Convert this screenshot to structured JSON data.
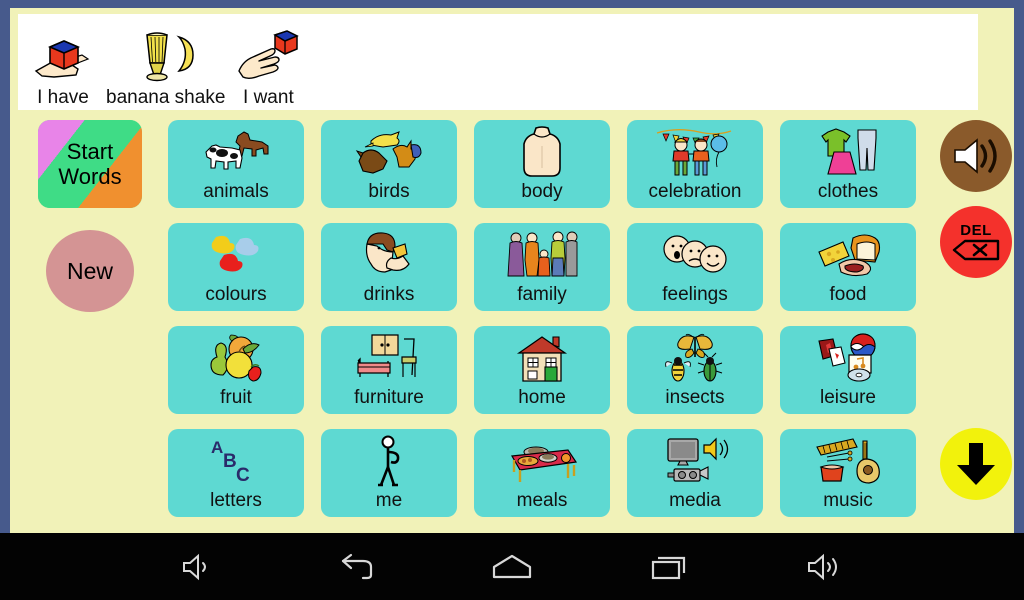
{
  "app": {
    "background_color": "#f1f2b8",
    "frame_color": "#475a8c",
    "cell_color": "#5ed9d2"
  },
  "sentence_bar": {
    "items": [
      {
        "label": "I have",
        "icon": "hand-holding-cube-icon"
      },
      {
        "label": "banana shake",
        "icon": "milkshake-banana-icon"
      },
      {
        "label": "I want",
        "icon": "hand-reaching-cube-icon"
      }
    ]
  },
  "left_column": {
    "start_words": {
      "line1": "Start",
      "line2": "Words",
      "name": "start-words-button"
    },
    "new_button": {
      "label": "New",
      "color": "#d49494"
    }
  },
  "grid": {
    "rows": [
      [
        {
          "label": "animals",
          "icon": "horse-cow-icon"
        },
        {
          "label": "birds",
          "icon": "birds-icon"
        },
        {
          "label": "body",
          "icon": "torso-icon"
        },
        {
          "label": "celebration",
          "icon": "party-children-balloon-icon"
        },
        {
          "label": "clothes",
          "icon": "jumper-trousers-skirt-icon"
        }
      ],
      [
        {
          "label": "colours",
          "icon": "paint-blobs-icon"
        },
        {
          "label": "drinks",
          "icon": "person-drinking-icon"
        },
        {
          "label": "family",
          "icon": "family-group-icon"
        },
        {
          "label": "feelings",
          "icon": "three-faces-icon"
        },
        {
          "label": "food",
          "icon": "bread-cheese-meat-icon"
        }
      ],
      [
        {
          "label": "fruit",
          "icon": "fruit-pile-icon"
        },
        {
          "label": "furniture",
          "icon": "bed-chair-wardrobe-icon"
        },
        {
          "label": "home",
          "icon": "house-icon"
        },
        {
          "label": "insects",
          "icon": "butterfly-bee-beetle-icon"
        },
        {
          "label": "leisure",
          "icon": "ball-cards-cd-icon"
        }
      ],
      [
        {
          "label": "letters",
          "icon": "abc-letters-icon",
          "glyphs": [
            "A",
            "B",
            "C"
          ]
        },
        {
          "label": "me",
          "icon": "stick-figure-icon"
        },
        {
          "label": "meals",
          "icon": "table-with-plates-icon"
        },
        {
          "label": "media",
          "icon": "tv-camcorder-icon"
        },
        {
          "label": "music",
          "icon": "xylophone-drum-guitar-icon"
        }
      ]
    ]
  },
  "right_column": {
    "speak_button": {
      "name": "speak-button",
      "icon": "speaker-icon",
      "color": "#8a5a2b"
    },
    "delete_button": {
      "name": "delete-button",
      "label": "DEL",
      "icon": "backspace-icon",
      "color": "#f4312c"
    },
    "down_button": {
      "name": "scroll-down-button",
      "icon": "arrow-down-icon",
      "color": "#f2f20c"
    }
  },
  "navbar": {
    "buttons": [
      {
        "name": "volume-down-button",
        "icon": "volume-down-icon"
      },
      {
        "name": "back-button",
        "icon": "back-arrow-icon"
      },
      {
        "name": "home-button",
        "icon": "home-icon"
      },
      {
        "name": "recents-button",
        "icon": "recent-apps-icon"
      },
      {
        "name": "volume-up-button",
        "icon": "volume-up-icon"
      }
    ]
  }
}
